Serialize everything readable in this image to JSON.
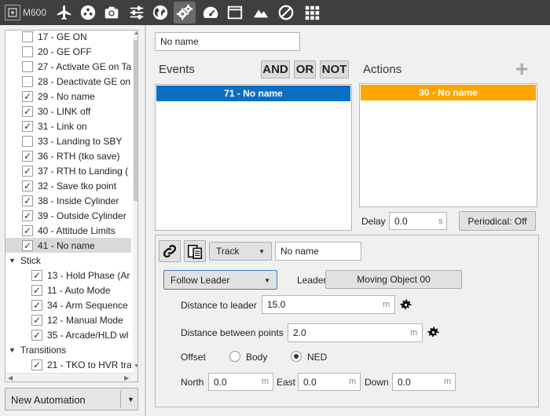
{
  "app": {
    "name": "M600"
  },
  "toolbar": {
    "icons": [
      "plane-icon",
      "status-icon",
      "camera-icon",
      "sliders-icon",
      "globe-icon",
      "gears-icon",
      "gauge-icon",
      "window-icon",
      "mountain-icon",
      "prohibited-icon",
      "grid-icon"
    ],
    "active": "gears-icon"
  },
  "tree": {
    "items": [
      {
        "label": "17 - GE ON",
        "checked": false
      },
      {
        "label": "20 - GE OFF",
        "checked": false
      },
      {
        "label": "27 - Activate GE on Ta",
        "checked": false
      },
      {
        "label": "28 - Deactivate GE on",
        "checked": false
      },
      {
        "label": "29 - No name",
        "checked": true
      },
      {
        "label": "30 - LINK off",
        "checked": true
      },
      {
        "label": "31 - Link on",
        "checked": true
      },
      {
        "label": "33 - Landing to SBY",
        "checked": false
      },
      {
        "label": "36 - RTH (tko save)",
        "checked": true
      },
      {
        "label": "37 - RTH to Landing (",
        "checked": true
      },
      {
        "label": "32 - Save tko point",
        "checked": true
      },
      {
        "label": "38 - Inside Cylinder",
        "checked": true
      },
      {
        "label": "39 - Outside Cylinder",
        "checked": true
      },
      {
        "label": "40 - Attitude Limits",
        "checked": true
      },
      {
        "label": "41 - No name",
        "checked": true,
        "selected": true
      }
    ],
    "group_stick": "Stick",
    "stick_items": [
      {
        "label": "13 - Hold Phase (Ar",
        "checked": true
      },
      {
        "label": "11 - Auto Mode",
        "checked": true
      },
      {
        "label": "34 - Arm Sequence",
        "checked": true
      },
      {
        "label": "12 - Manual Mode",
        "checked": true
      },
      {
        "label": "35 - Arcade/HLD wl",
        "checked": true
      }
    ],
    "group_transitions": "Transitions",
    "transition_items": [
      {
        "label": "21 - TKO to HVR tra",
        "checked": true
      }
    ]
  },
  "new_automation": {
    "label": "New Automation"
  },
  "automation": {
    "name": "No name"
  },
  "events": {
    "title": "Events",
    "and_label": "AND",
    "or_label": "OR",
    "not_label": "NOT",
    "item": "71 - No name",
    "item_color": "#0a6fc2"
  },
  "actions": {
    "title": "Actions",
    "add_label": "+",
    "item": "30 - No name",
    "item_color": "#ffa500"
  },
  "delay": {
    "label": "Delay",
    "value": "0.0",
    "unit": "s"
  },
  "periodical": {
    "label": "Periodical: Off"
  },
  "action_editor": {
    "type_select": "Track",
    "name": "No name",
    "mode_select": "Follow Leader",
    "leader_label": "Leader",
    "leader_value": "Moving Object 00",
    "distance_leader_label": "Distance to leader",
    "distance_leader_value": "15.0",
    "distance_points_label": "Distance between points",
    "distance_points_value": "2.0",
    "unit_m": "m",
    "offset_label": "Offset",
    "offset_options": [
      "Body",
      "NED"
    ],
    "offset_selected": "NED",
    "north_label": "North",
    "north_value": "0.0",
    "east_label": "East",
    "east_value": "0.0",
    "down_label": "Down",
    "down_value": "0.0"
  }
}
